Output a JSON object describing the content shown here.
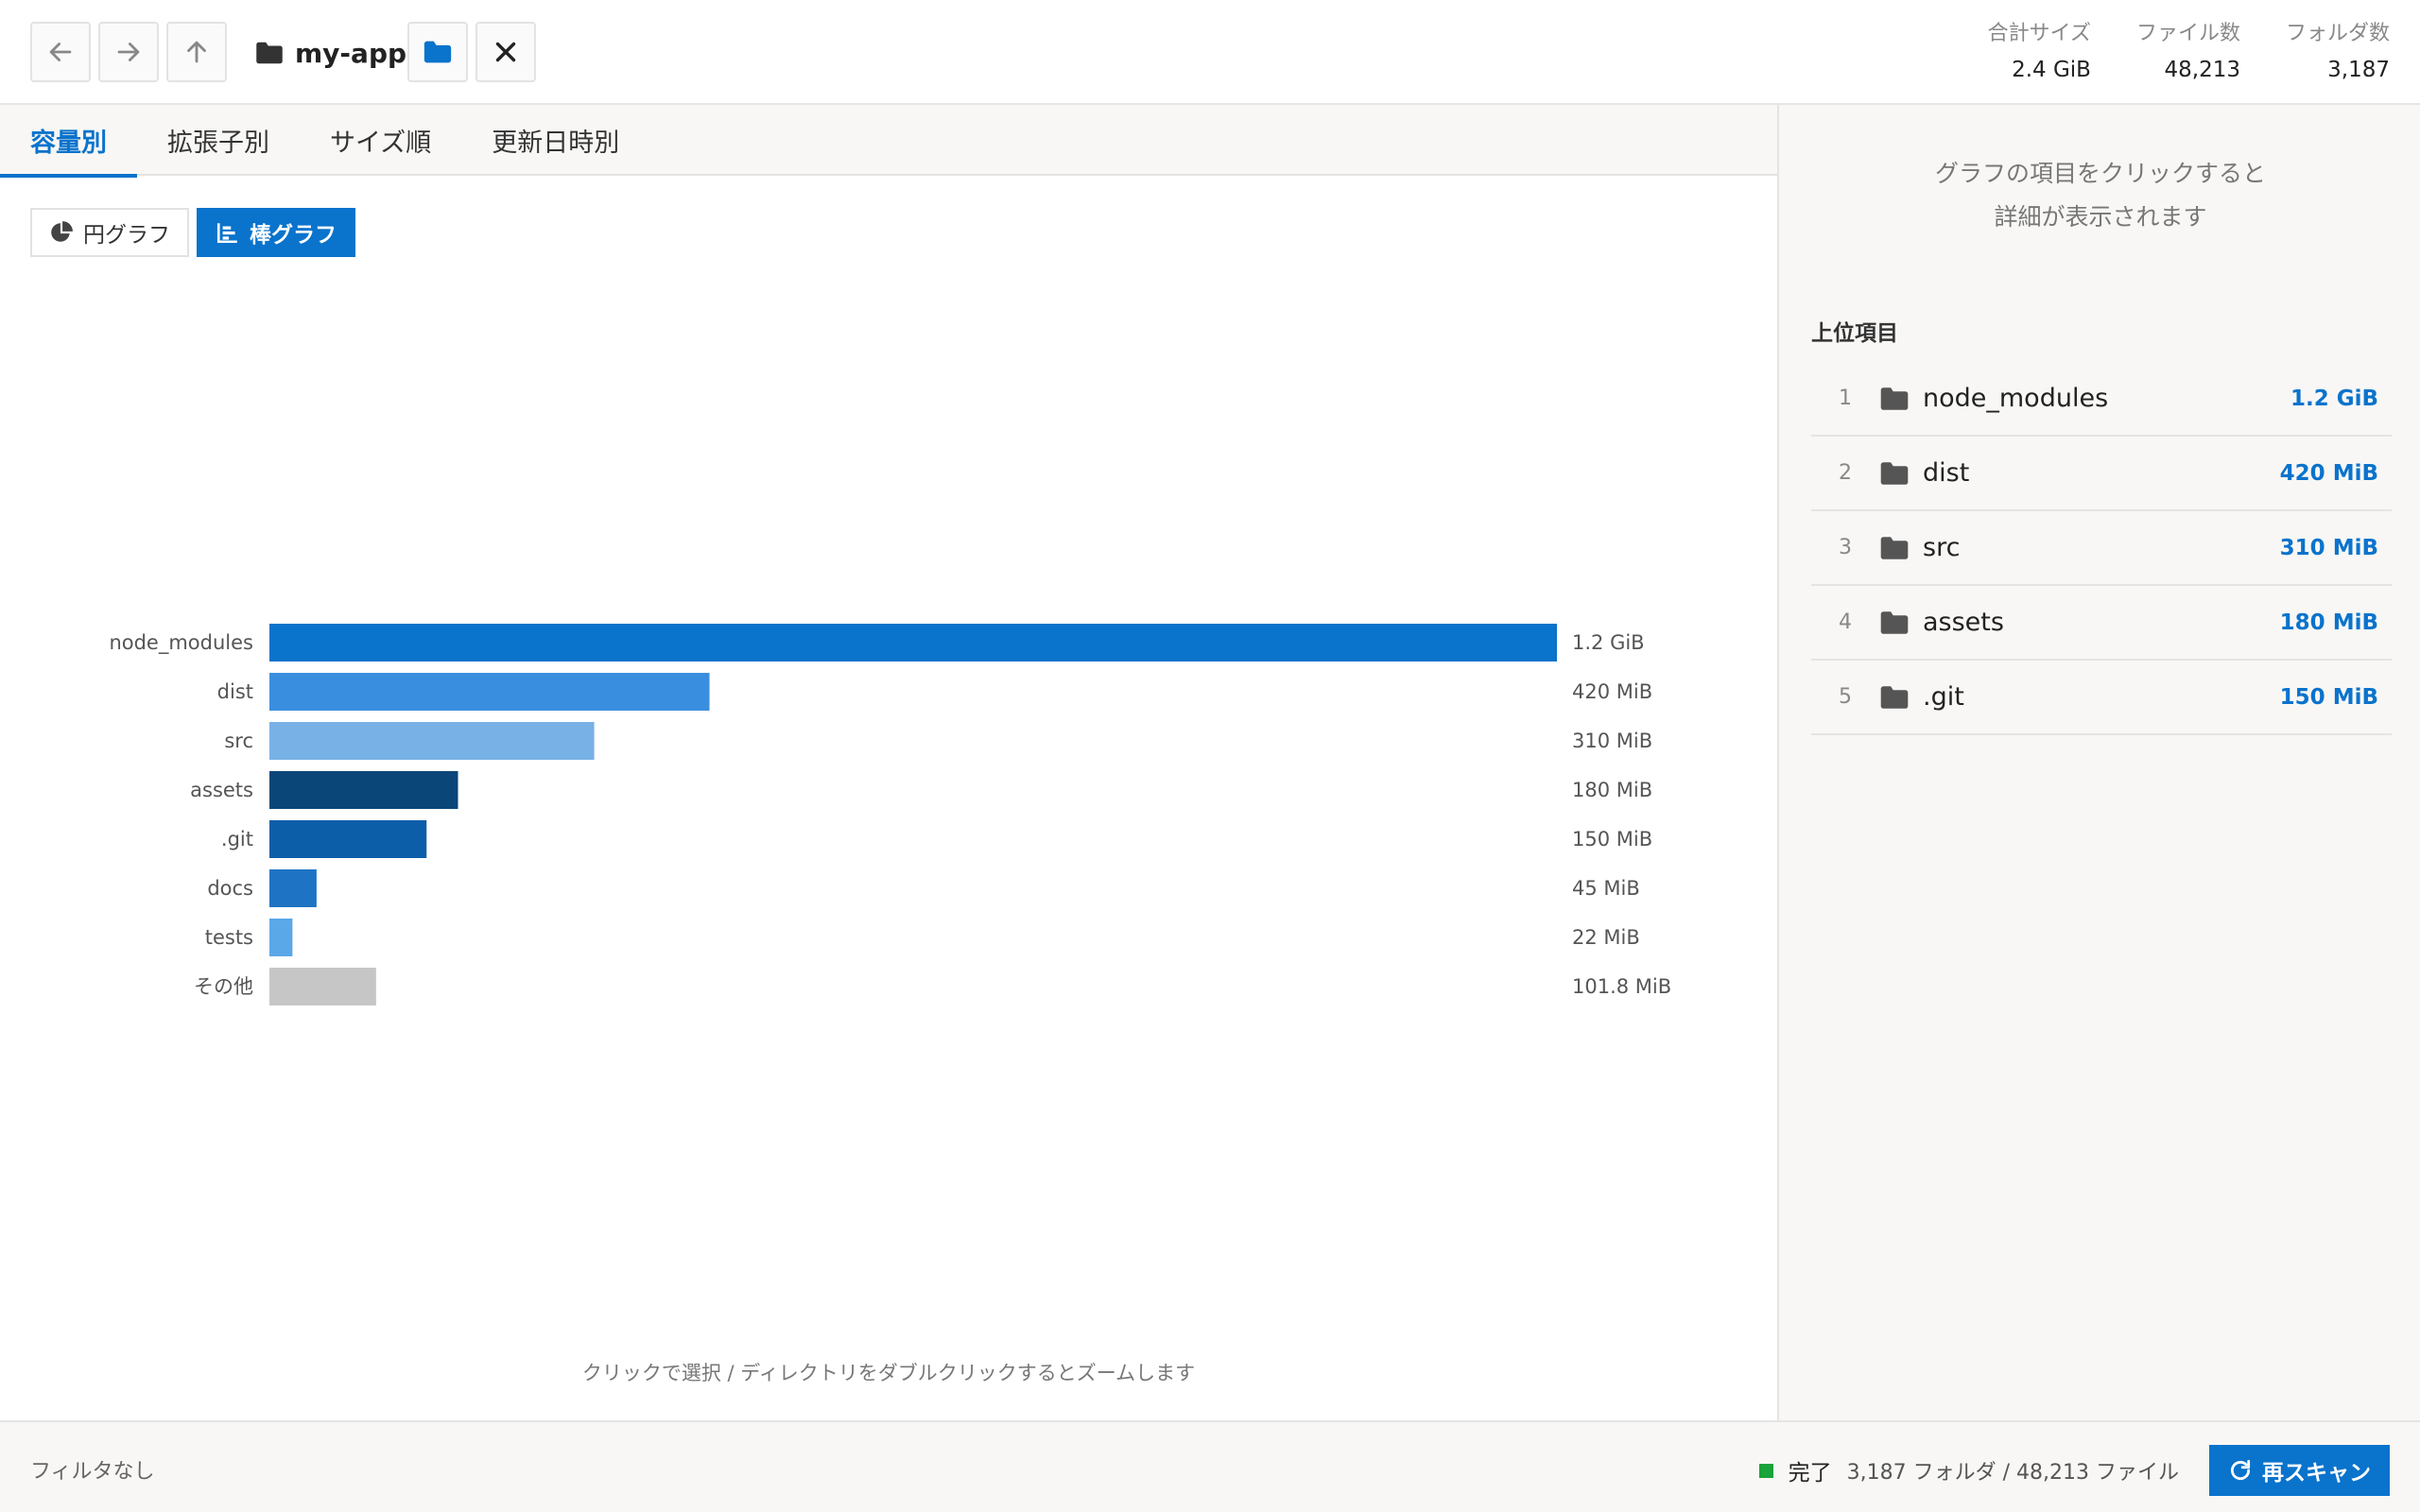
{
  "header": {
    "path": "my-app",
    "stats": [
      {
        "label": "合計サイズ",
        "value": "2.4 GiB"
      },
      {
        "label": "ファイル数",
        "value": "48,213"
      },
      {
        "label": "フォルダ数",
        "value": "3,187"
      }
    ]
  },
  "tabs": [
    "容量別",
    "拡張子別",
    "サイズ順",
    "更新日時別"
  ],
  "view_toggle": {
    "pie": "円グラフ",
    "bar": "棒グラフ"
  },
  "chart_data": {
    "type": "bar",
    "orientation": "horizontal",
    "categories": [
      "node_modules",
      "dist",
      "src",
      "assets",
      ".git",
      "docs",
      "tests",
      "その他"
    ],
    "values_mib": [
      1228.8,
      420,
      310,
      180,
      150,
      45,
      22,
      101.8
    ],
    "value_labels": [
      "1.2 GiB",
      "420 MiB",
      "310 MiB",
      "180 MiB",
      "150 MiB",
      "45 MiB",
      "22 MiB",
      "101.8 MiB"
    ],
    "colors": [
      "#0a73cc",
      "#3a8ee0",
      "#78b1e6",
      "#0a4677",
      "#0d5ea8",
      "#1f73c4",
      "#5aa8e8",
      "#c6c6c6"
    ],
    "grid": false,
    "hint": "クリックで選択 / ディレクトリをダブルクリックするとズームします"
  },
  "side": {
    "message_line1": "グラフの項目をクリックすると",
    "message_line2": "詳細が表示されます",
    "title": "上位項目",
    "items": [
      {
        "rank": "1",
        "name": "node_modules",
        "size": "1.2 GiB"
      },
      {
        "rank": "2",
        "name": "dist",
        "size": "420 MiB"
      },
      {
        "rank": "3",
        "name": "src",
        "size": "310 MiB"
      },
      {
        "rank": "4",
        "name": "assets",
        "size": "180 MiB"
      },
      {
        "rank": "5",
        "name": ".git",
        "size": "150 MiB"
      }
    ]
  },
  "status": {
    "filter": "フィルタなし",
    "state": "完了",
    "counts": "3,187 フォルダ / 48,213 ファイル",
    "rescan": "再スキャン"
  },
  "colors": {
    "accent": "#0a73cc",
    "success": "#1aa33a"
  }
}
